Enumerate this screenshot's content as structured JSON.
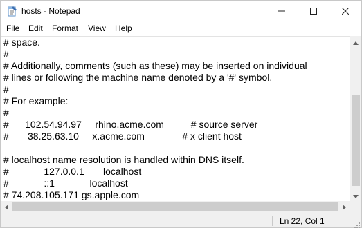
{
  "window": {
    "title": "hosts - Notepad",
    "icon": "notepad-icon"
  },
  "caption_buttons": {
    "minimize": "minimize-icon",
    "maximize": "maximize-icon",
    "close": "close-icon"
  },
  "menu": [
    "File",
    "Edit",
    "Format",
    "View",
    "Help"
  ],
  "editor": {
    "lines": [
      "# space.",
      "#",
      "# Additionally, comments (such as these) may be inserted on individual",
      "# lines or following the machine name denoted by a '#' symbol.",
      "#",
      "# For example:",
      "#",
      "#      102.54.94.97     rhino.acme.com          # source server",
      "#       38.25.63.10     x.acme.com              # x client host",
      "",
      "# localhost name resolution is handled within DNS itself.",
      "#             127.0.0.1       localhost",
      "#             ::1             localhost",
      "# 74.208.105.171 gs.apple.com"
    ]
  },
  "status": {
    "position": "Ln 22, Col 1"
  },
  "scroll": {
    "vertical_icons": [
      "chevron-up-icon",
      "chevron-down-icon"
    ],
    "horizontal_icons": [
      "chevron-left-icon",
      "chevron-right-icon"
    ]
  }
}
